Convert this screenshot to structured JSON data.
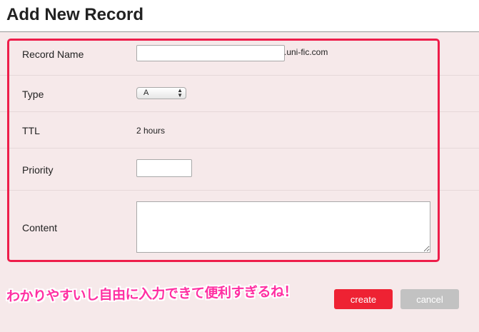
{
  "page": {
    "title": "Add New Record"
  },
  "form": {
    "record_name": {
      "label": "Record Name",
      "value": "",
      "suffix": ".uni-fic.com"
    },
    "type": {
      "label": "Type",
      "selected": "A"
    },
    "ttl": {
      "label": "TTL",
      "value": "2 hours"
    },
    "priority": {
      "label": "Priority",
      "value": ""
    },
    "content": {
      "label": "Content",
      "value": ""
    }
  },
  "annotation": {
    "text": "わかりやすいし自由に入力できて便利すぎるね！",
    "color": "#ff2fa2",
    "box_color": "#ee1d4a"
  },
  "actions": {
    "create_label": "create",
    "cancel_label": "cancel"
  },
  "colors": {
    "background": "#f6e9ea",
    "create": "#ee2233",
    "cancel": "#c2c2c2"
  }
}
